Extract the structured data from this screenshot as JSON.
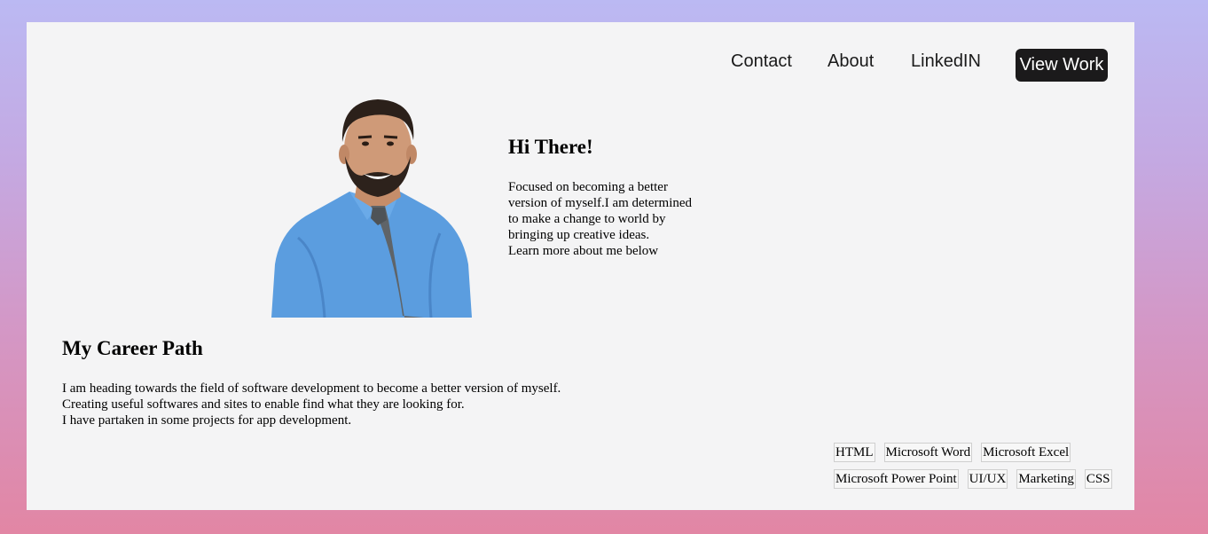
{
  "nav": {
    "links": [
      "Contact",
      "About",
      "LinkedIN"
    ],
    "cta": "View Work"
  },
  "hero": {
    "title": "Hi There!",
    "lines": [
      "Focused on becoming a better",
      "version of myself.I am determined",
      "to make a change to world by",
      "bringing up creative ideas.",
      "Learn more about me below"
    ],
    "portrait_alt": "man in blue shirt and tie"
  },
  "career": {
    "title": "My Career Path",
    "lines": [
      "I am heading towards the field of software development to become a better version of myself.",
      "Creating useful softwares and sites to enable find what they are looking for.",
      "I have partaken in some projects for app development."
    ]
  },
  "skills": {
    "row1": [
      "HTML",
      "Microsoft Word",
      "Microsoft Excel"
    ],
    "row2": [
      "Microsoft Power Point",
      "UI/UX",
      "Marketing",
      "CSS"
    ]
  },
  "colors": {
    "gradient_top": "#bbb9f3",
    "gradient_bottom": "#e286a4",
    "card": "#f4f4f5",
    "button": "#1b1a1b"
  }
}
